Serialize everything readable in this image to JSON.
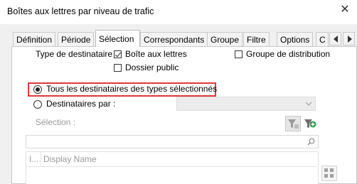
{
  "window": {
    "title": "Boîtes aux lettres par niveau de trafic",
    "close_glyph": "✕"
  },
  "tabs": [
    {
      "label": "Définition",
      "active": false
    },
    {
      "label": "Période",
      "active": false
    },
    {
      "label": "Sélection",
      "active": true
    },
    {
      "label": "Correspondants",
      "active": false
    },
    {
      "label": "Groupe",
      "active": false
    },
    {
      "label": "Filtre",
      "active": false
    },
    {
      "label": "Options",
      "active": false
    },
    {
      "label": "C",
      "active": false
    }
  ],
  "recipient_type": {
    "label": "Type de destinataire",
    "mailbox": {
      "label": "Boîte aux lettres",
      "checked": true
    },
    "public_folder": {
      "label": "Dossier public",
      "checked": false
    },
    "distribution_group": {
      "label": "Groupe de distribution",
      "checked": false
    }
  },
  "scope": {
    "all_selected_types": {
      "label": "Tous les destinataires des types sélectionnés",
      "selected": true
    },
    "recipients_by": {
      "label": "Destinataires par :",
      "selected": false,
      "value": ""
    }
  },
  "selection": {
    "label": "Sélection :",
    "search_placeholder": "",
    "columns": [
      "I...",
      "Display Name"
    ]
  },
  "icons": {
    "filter_clear": "filter-clear-icon",
    "filter_add": "filter-add-icon",
    "search": "search-icon",
    "grid_view": "grid-view-icon"
  },
  "colors": {
    "highlight": "#e03a3a",
    "disabled_text": "#9a9a9a"
  }
}
